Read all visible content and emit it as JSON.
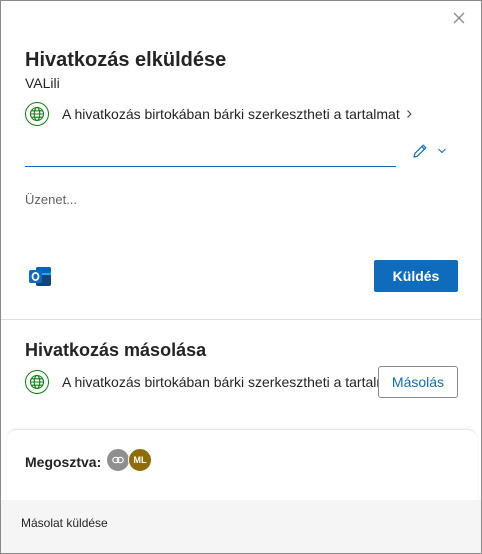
{
  "dialog": {
    "close_icon": "close-icon"
  },
  "send_link": {
    "title": "Hivatkozás elküldése",
    "file_name": "VALili",
    "permission_text": "A hivatkozás birtokában bárki szerkesztheti a tartalmat",
    "to_value": "",
    "to_placeholder": "",
    "message_value": "",
    "message_placeholder": "Üzenet...",
    "send_label": "Küldés",
    "accent": "#0f6cbd"
  },
  "copy_link": {
    "title": "Hivatkozás másolása",
    "permission_text": "A hivatkozás birtokában bárki szerkesztheti a tartalmat",
    "copy_label": "Másolás"
  },
  "shared": {
    "label": "Megosztva:",
    "avatars": [
      {
        "type": "link-icon",
        "color": "#8f8f8f"
      },
      {
        "initials": "ML",
        "color": "#8f6c08"
      }
    ]
  },
  "footer": {
    "send_copy_label": "Másolat küldése"
  }
}
